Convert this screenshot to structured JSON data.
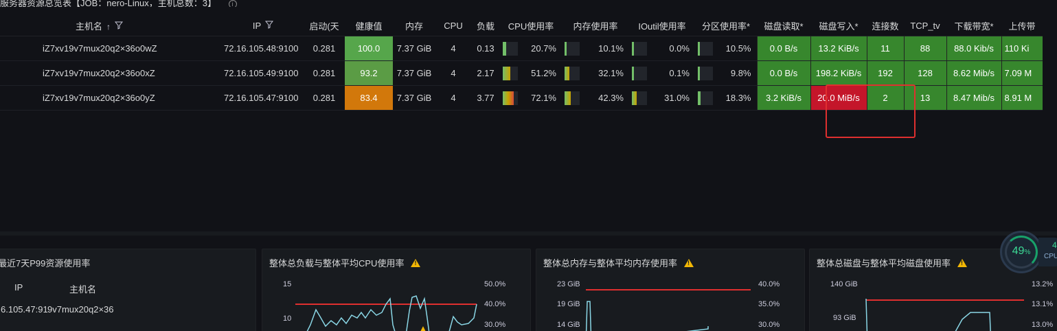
{
  "page": {
    "title": "服务器资源总览表【JOB：nero-Linux，主机总数：3】"
  },
  "table": {
    "headers": {
      "hostname": "主机名",
      "ip": "IP",
      "uptime": "启动(天",
      "health": "健康值",
      "memory": "内存",
      "cpu": "CPU",
      "load": "负载",
      "cpu_usage": "CPU使用率",
      "mem_usage": "内存使用率",
      "ioutil": "IOutil使用率",
      "part_usage": "分区使用率*",
      "disk_read": "磁盘读取*",
      "disk_write": "磁盘写入*",
      "conns": "连接数",
      "tcp_tw": "TCP_tv",
      "download": "下载带宽*",
      "upload": "上传带"
    },
    "rows": [
      {
        "hostname": "iZ7xv19v7mux20q2×36o0wZ",
        "ip": "72.16.105.48:9100",
        "uptime": "0.281",
        "health": "100.0",
        "memory": "7.37 GiB",
        "cpu": "4",
        "load": "0.13",
        "cpu_usage": "20.7%",
        "cpu_usage_level": 0.207,
        "mem_usage": "10.1%",
        "mem_usage_level": 0.101,
        "ioutil": "0.0%",
        "ioutil_level": 0.0,
        "part_usage": "10.5%",
        "part_usage_level": 0.105,
        "disk_read": "0.0 B/s",
        "disk_write": "13.2 KiB/s",
        "conns": "11",
        "tcp_tw": "88",
        "download": "88.0 Kib/s",
        "upload": "110 Ki"
      },
      {
        "hostname": "iZ7xv19v7mux20q2×36o0xZ",
        "ip": "72.16.105.49:9100",
        "uptime": "0.281",
        "health": "93.2",
        "memory": "7.37 GiB",
        "cpu": "4",
        "load": "2.17",
        "cpu_usage": "51.2%",
        "cpu_usage_level": 0.512,
        "mem_usage": "32.1%",
        "mem_usage_level": 0.321,
        "ioutil": "0.1%",
        "ioutil_level": 0.001,
        "part_usage": "9.8%",
        "part_usage_level": 0.098,
        "disk_read": "0.0 B/s",
        "disk_write": "198.2 KiB/s",
        "conns": "192",
        "tcp_tw": "128",
        "download": "8.62 Mib/s",
        "upload": "7.09 M"
      },
      {
        "hostname": "iZ7xv19v7mux20q2×36o0yZ",
        "ip": "72.16.105.47:9100",
        "uptime": "0.281",
        "health": "83.4",
        "memory": "7.37 GiB",
        "cpu": "4",
        "load": "3.77",
        "cpu_usage": "72.1%",
        "cpu_usage_level": 0.721,
        "mem_usage": "42.3%",
        "mem_usage_level": 0.423,
        "ioutil": "31.0%",
        "ioutil_level": 0.31,
        "part_usage": "18.3%",
        "part_usage_level": 0.183,
        "disk_read": "3.2 KiB/s",
        "disk_write": "20.0 MiB/s",
        "conns": "2",
        "tcp_tw": "13",
        "download": "8.47 Mib/s",
        "upload": "8.91 M"
      }
    ]
  },
  "panels": {
    "p99": {
      "title": "最近7天P99资源使用率",
      "col_ip": "IP",
      "col_host": "主机名",
      "row_ip": "6.105.47:91",
      "row_host": "9v7mux20q2×36"
    },
    "load_cpu": {
      "title": "整体总负载与整体平均CPU使用率",
      "left_ticks": [
        "15",
        "10"
      ],
      "right_ticks": [
        "50.0%",
        "40.0%",
        "30.0%"
      ]
    },
    "mem": {
      "title": "整体总内存与整体平均内存使用率",
      "left_ticks": [
        "23 GiB",
        "19 GiB",
        "14 GiB"
      ],
      "right_ticks": [
        "40.0%",
        "35.0%",
        "30.0%"
      ]
    },
    "disk": {
      "title": "整体总磁盘与整体平均磁盘使用率",
      "left_ticks": [
        "140 GiB",
        "93 GiB"
      ],
      "right_ticks": [
        "13.2%",
        "13.1%",
        "13.0%"
      ]
    }
  },
  "widget": {
    "cpu_pct": "49",
    "pct_sign": "%",
    "side_num": "4",
    "side_label": "CPU"
  },
  "colors": {
    "accent_blue": "#5794f2",
    "green": "#37872d",
    "red": "#c4162a",
    "orange": "#d2780b",
    "threshold_red": "#e02f2f",
    "line_cyan": "#8ad7e6"
  }
}
